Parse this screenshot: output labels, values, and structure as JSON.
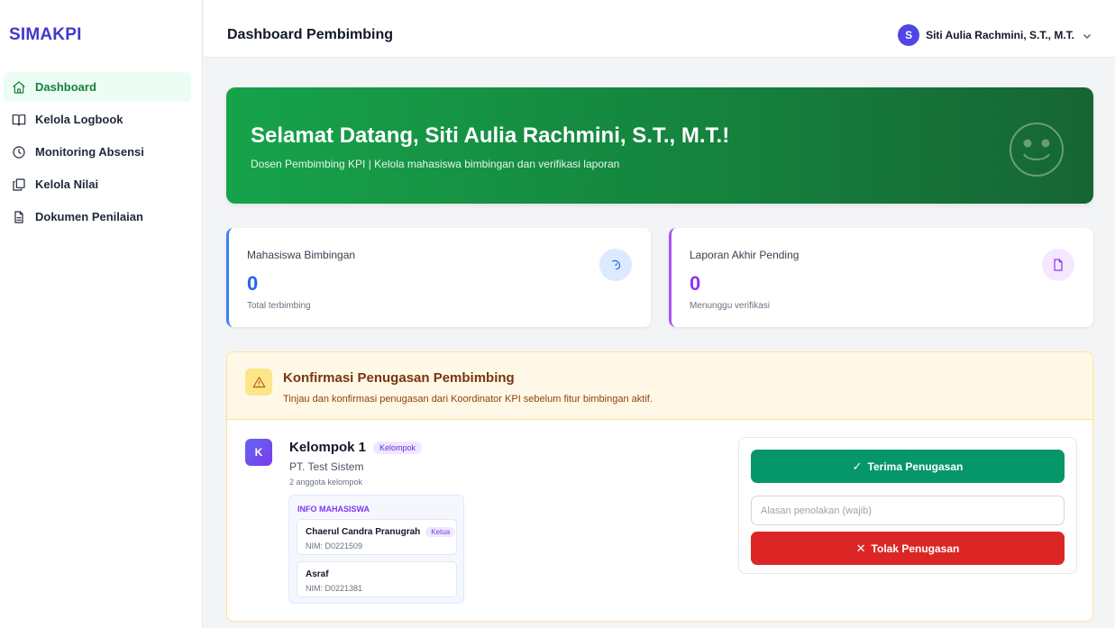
{
  "app": {
    "brand": "SIMAKPI"
  },
  "sidebar": {
    "items": [
      {
        "label": "Dashboard",
        "icon": "home-icon",
        "active": true
      },
      {
        "label": "Kelola Logbook",
        "icon": "book-icon",
        "active": false
      },
      {
        "label": "Monitoring Absensi",
        "icon": "clock-icon",
        "active": false
      },
      {
        "label": "Kelola Nilai",
        "icon": "copy-icon",
        "active": false
      },
      {
        "label": "Dokumen Penilaian",
        "icon": "document-icon",
        "active": false
      }
    ]
  },
  "header": {
    "title": "Dashboard Pembimbing",
    "user_initial": "S",
    "user_name": "Siti Aulia Rachmini, S.T., M.T."
  },
  "banner": {
    "title": "Selamat Datang, Siti Aulia Rachmini, S.T., M.T.!",
    "subtitle": "Dosen Pembimbing KPI | Kelola mahasiswa bimbingan dan verifikasi laporan",
    "icon": "smile-icon"
  },
  "stats": [
    {
      "label": "Mahasiswa Bimbingan",
      "value": "0",
      "caption": "Total terbimbing",
      "icon": "users-icon",
      "color": "#2563eb"
    },
    {
      "label": "Laporan Akhir Pending",
      "value": "0",
      "caption": "Menunggu verifikasi",
      "icon": "file-icon",
      "color": "#9333ea"
    }
  ],
  "confirmation": {
    "title": "Konfirmasi Penugasan Pembimbing",
    "subtitle": "Tinjau dan konfirmasi penugasan dari Koordinator KPI sebelum fitur bimbingan aktif.",
    "group": {
      "initial": "K",
      "name": "Kelompok 1",
      "tag": "Kelompok",
      "company": "PT. Test Sistem",
      "members_count": "2 anggota kelompok",
      "info_title": "INFO MAHASISWA",
      "students": [
        {
          "name": "Chaerul Candra Pranugrah",
          "role": "Ketua",
          "nim": "NIM: D0221509"
        },
        {
          "name": "Asraf",
          "role": "",
          "nim": "NIM: D0221381"
        }
      ]
    },
    "actions": {
      "accept_label": "Terima Penugasan",
      "accept_glyph": "✓",
      "reason_placeholder": "Alasan penolakan (wajib)",
      "reason_value": "",
      "reject_label": "Tolak Penugasan",
      "reject_glyph": "✕"
    }
  },
  "colors": {
    "brand": "#4338ca",
    "banner": "#16a34a",
    "accept": "#059669",
    "reject": "#dc2626"
  }
}
